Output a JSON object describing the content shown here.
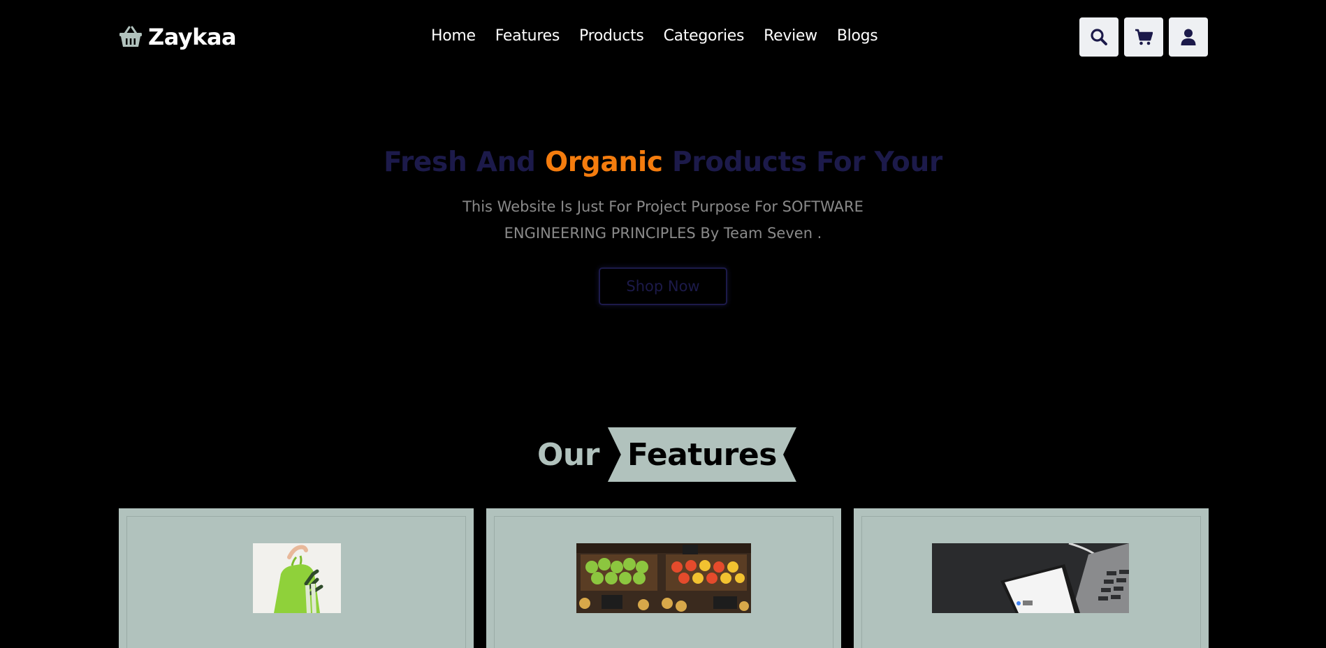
{
  "brand": {
    "name": "Zaykaa",
    "logo_icon": "basket-icon"
  },
  "nav": {
    "items": [
      "Home",
      "Features",
      "Products",
      "Categories",
      "Review",
      "Blogs"
    ]
  },
  "header_icons": [
    "search-icon",
    "cart-icon",
    "user-icon"
  ],
  "hero": {
    "title_part1": "Fresh And ",
    "title_accent": "Organic",
    "title_part2": " Products For Your",
    "subtitle": "This Website Is Just For Project Purpose For SOFTWARE ENGINEERING PRINCIPLES By Team Seven .",
    "button_label": "Shop Now"
  },
  "features": {
    "heading_prefix": "Our",
    "heading_main": "Features"
  },
  "colors": {
    "background": "#000000",
    "accent": "#f47c0e",
    "heading_dark": "#1c1a4a",
    "sage": "#b1c2bd",
    "icon_button_bg": "#eef0f3"
  }
}
